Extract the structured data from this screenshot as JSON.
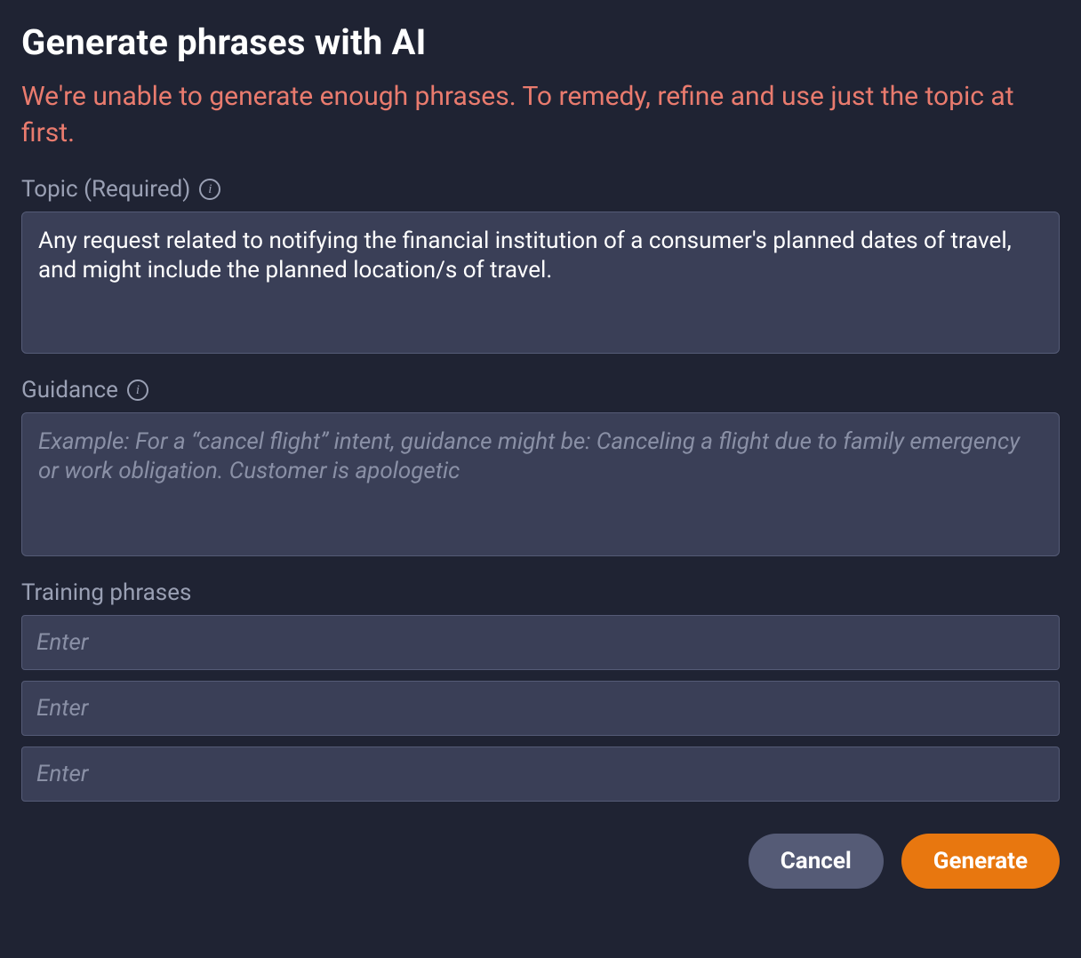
{
  "header": {
    "title": "Generate phrases with AI",
    "error": "We're unable to generate enough phrases. To remedy, refine and use just the topic at first."
  },
  "form": {
    "topic": {
      "label": "Topic (Required)",
      "value": "Any request related to notifying the financial institution of a consumer's planned dates of travel, and might include the planned location/s of travel."
    },
    "guidance": {
      "label": "Guidance",
      "placeholder": "Example: For a “cancel flight” intent, guidance might be: Canceling a flight due to family emergency or work obligation. Customer is apologetic",
      "value": ""
    },
    "training": {
      "label": "Training phrases",
      "phrases": [
        {
          "placeholder": "Enter",
          "value": ""
        },
        {
          "placeholder": "Enter",
          "value": ""
        },
        {
          "placeholder": "Enter",
          "value": ""
        }
      ]
    }
  },
  "footer": {
    "cancel_label": "Cancel",
    "generate_label": "Generate"
  }
}
